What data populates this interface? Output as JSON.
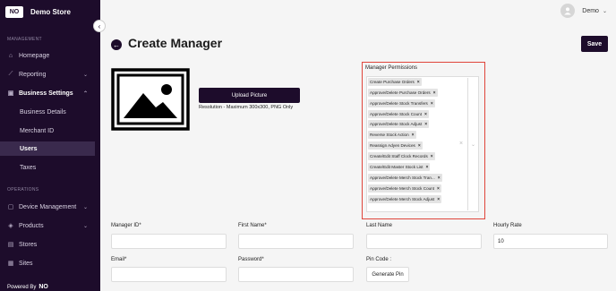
{
  "brand": {
    "logo_text": "NO",
    "name": "Demo Store"
  },
  "header": {
    "user_name": "Demo",
    "avatar_icon": "user-icon",
    "collapse_icon": "chevron-left-icon"
  },
  "sidebar": {
    "sections": [
      "MANAGEMENT",
      "OPERATIONS"
    ],
    "items": [
      {
        "label": "Homepage",
        "icon": "home-icon"
      },
      {
        "label": "Reporting",
        "icon": "chart-icon"
      },
      {
        "label": "Business Settings",
        "icon": "briefcase-icon"
      },
      {
        "label": "Business Details"
      },
      {
        "label": "Merchant ID"
      },
      {
        "label": "Users"
      },
      {
        "label": "Taxes"
      },
      {
        "label": "Device Management",
        "icon": "device-icon"
      },
      {
        "label": "Products",
        "icon": "products-icon"
      },
      {
        "label": "Stores",
        "icon": "store-icon"
      },
      {
        "label": "Sites",
        "icon": "sites-icon"
      }
    ],
    "powered_by": "Powered By",
    "powered_brand": "NO"
  },
  "page": {
    "title": "Create Manager",
    "save_label": "Save"
  },
  "image": {
    "upload_label": "Upload Picture",
    "resolution_note": "Resolution - Maximum 300x300, PNG Only"
  },
  "permissions": {
    "label": "Manager Permissions",
    "selected": [
      "Create Purchase Orders",
      "Approve/Delete Purchase Orders",
      "Approve/Delete Stock Transfers",
      "Approve/Delete Stock Count",
      "Approve/Delete Stock Adjust",
      "Reverse Stock Action",
      "Reassign Adyen Devices",
      "Create/Edit Staff Clock Records",
      "Create/Edit Master Stock List",
      "Approve/Delete Merch Stock Tran...",
      "Approve/Delete Merch Stock Count",
      "Approve/Delete Merch Stock Adjust"
    ],
    "remove_symbol": "×",
    "clear_symbol": "×"
  },
  "form": {
    "manager_id_label": "Manager ID*",
    "first_name_label": "First Name*",
    "last_name_label": "Last Name",
    "hourly_rate_label": "Hourly Rate",
    "hourly_rate_value": "10",
    "email_label": "Email*",
    "password_label": "Password*",
    "pin_code_label": "Pin Code :",
    "generate_pin_label": "Generate Pin"
  }
}
